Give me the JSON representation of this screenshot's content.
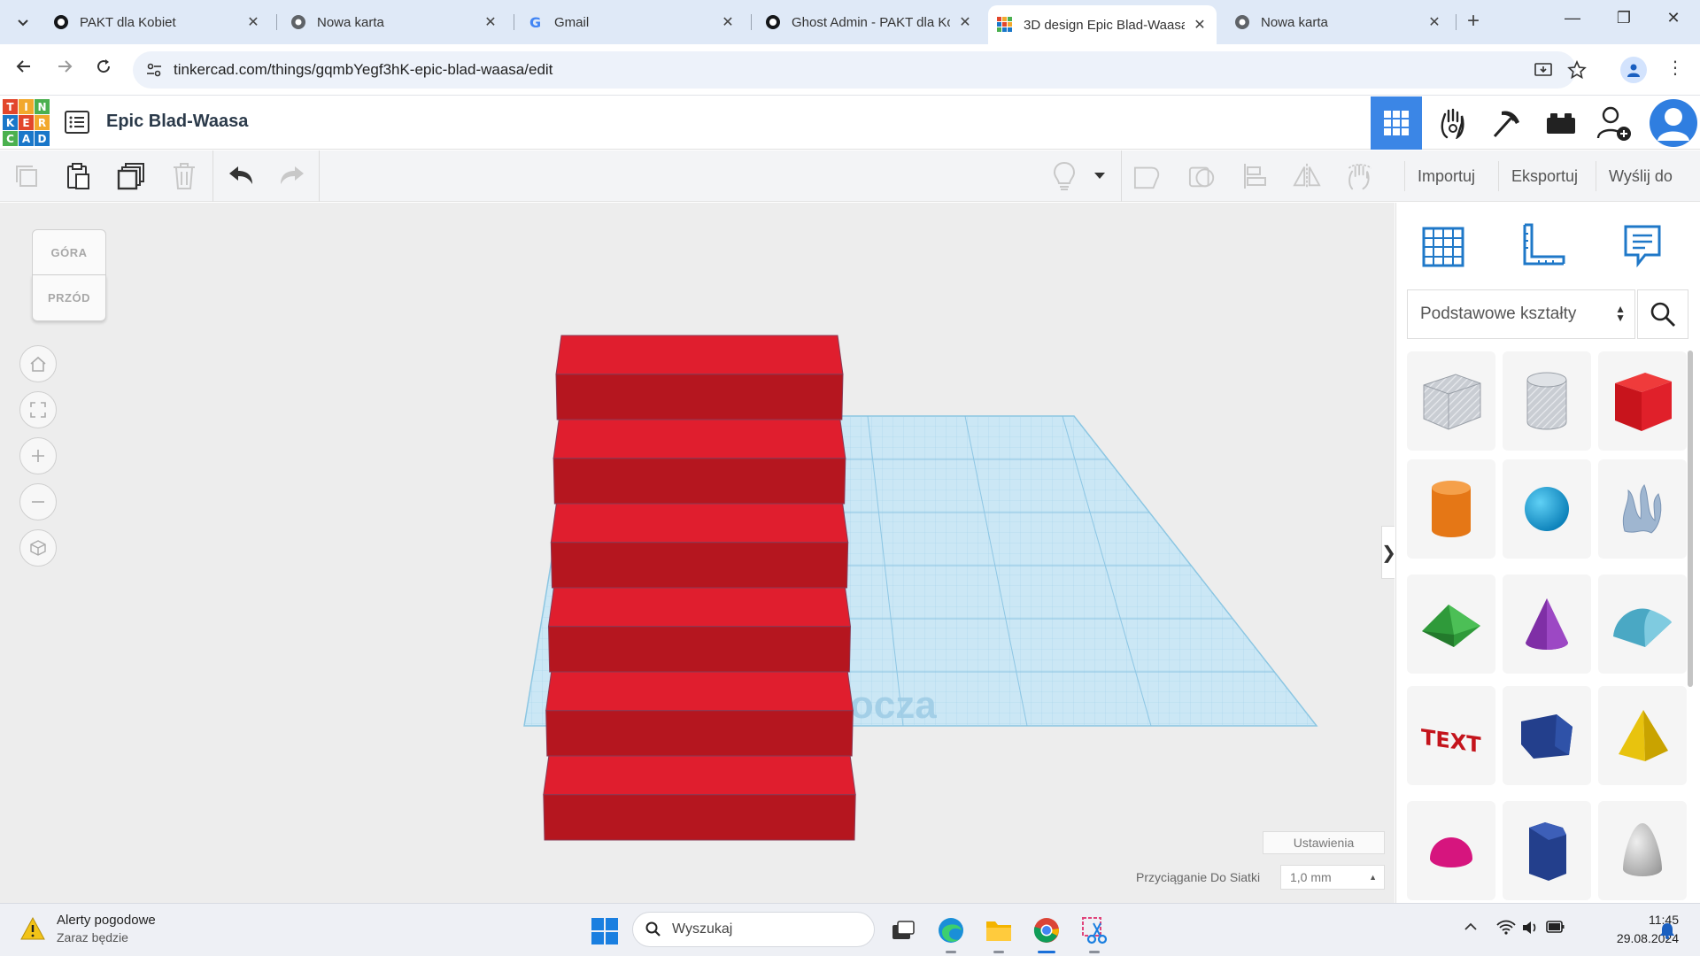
{
  "browser": {
    "tabs": [
      {
        "title": "PAKT dla Kobiet",
        "icon": "ghost-icon"
      },
      {
        "title": "Nowa karta",
        "icon": "chrome-icon"
      },
      {
        "title": "Gmail",
        "icon": "google-icon"
      },
      {
        "title": "Ghost Admin - PAKT dla Ko",
        "icon": "ghost-icon"
      },
      {
        "title": "3D design Epic Blad-Waasa",
        "icon": "tinkercad-icon",
        "active": true
      },
      {
        "title": "Nowa karta",
        "icon": "chrome-icon"
      }
    ],
    "url": "tinkercad.com/things/gqmbYegf3hK-epic-blad-waasa/edit"
  },
  "tinkercad": {
    "logo_letters": [
      "T",
      "I",
      "N",
      "K",
      "E",
      "R",
      "C",
      "A",
      "D"
    ],
    "logo_colors": [
      "#e2462b",
      "#f2a82c",
      "#4bb04f",
      "#1a77c9",
      "#e2462b",
      "#f2a82c",
      "#4bb04f",
      "#1a77c9",
      "#1a77c9"
    ],
    "design_title": "Epic Blad-Waasa",
    "toolbar": {
      "import_label": "Importuj",
      "export_label": "Eksportuj",
      "send_label": "Wyślij do"
    },
    "viewcube": {
      "top": "GÓRA",
      "front": "PRZÓD"
    },
    "workplane_label": "Płaszczyzna robocza",
    "settings_label": "Ustawienia",
    "snap_label": "Przyciąganie Do Siatki",
    "snap_value": "1,0 mm",
    "stair_steps": 6,
    "stair_color": "#e01e2e",
    "library": {
      "selected": "Podstawowe kształty",
      "shapes": [
        "Pole (otwór)",
        "Walec (otwór)",
        "Pole",
        "Walec",
        "Sfera",
        "Bazgroły",
        "Dach",
        "Stożek",
        "Dach okrągły",
        "Tekst",
        "Pryzmat",
        "Piramida",
        "Półsfera",
        "Wielokąt",
        "Paraboloida"
      ]
    }
  },
  "taskbar": {
    "weather_title": "Alerty pogodowe",
    "weather_sub": "Zaraz będzie",
    "search_placeholder": "Wyszukaj",
    "time": "11:45",
    "date": "29.08.2024"
  }
}
